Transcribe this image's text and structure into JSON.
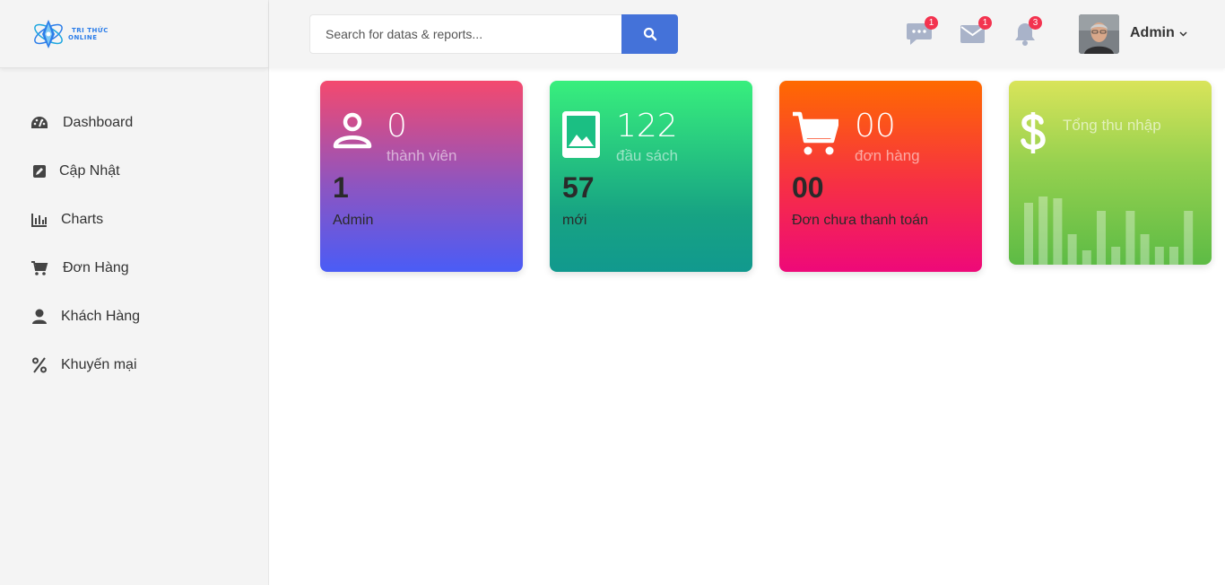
{
  "brand": {
    "line1": "TRI THỨC",
    "line2": "ONLINE"
  },
  "search": {
    "placeholder": "Search for datas & reports..."
  },
  "header": {
    "icons": [
      {
        "name": "chat-icon",
        "badge": "1"
      },
      {
        "name": "mail-icon",
        "badge": "1"
      },
      {
        "name": "bell-icon",
        "badge": "3"
      }
    ],
    "user": {
      "name": "Admin"
    }
  },
  "sidebar": {
    "items": [
      {
        "icon": "dashboard-icon",
        "label": "Dashboard"
      },
      {
        "icon": "edit-icon",
        "label": "Cập Nhật"
      },
      {
        "icon": "chart-icon",
        "label": "Charts"
      },
      {
        "icon": "cart-icon",
        "label": "Đơn Hàng"
      },
      {
        "icon": "user-icon",
        "label": "Khách Hàng"
      },
      {
        "icon": "percent-icon",
        "label": "Khuyến mại"
      }
    ]
  },
  "cards": [
    {
      "icon": "user-icon",
      "value": "0",
      "unit": "thành viên",
      "count": "1",
      "desc": "Admin",
      "colors": [
        "#f4496e",
        "#4a5cf6"
      ]
    },
    {
      "icon": "image-icon",
      "value": "122",
      "unit": "đầu sách",
      "count": "57",
      "desc": "mới",
      "colors": [
        "#38ef7d",
        "#11998e"
      ]
    },
    {
      "icon": "cart-icon",
      "value": "00",
      "unit": "đơn hàng",
      "count": "00",
      "desc": "Đơn chưa thanh toán",
      "colors": [
        "#ff6a00",
        "#ee0979"
      ]
    },
    {
      "icon": "dollar-icon",
      "title": "Tổng thu nhập",
      "sparkline": [
        0.74,
        0.82,
        0.8,
        0.37,
        0.17,
        0.65,
        0.22,
        0.65,
        0.37,
        0.22,
        0.22,
        0.65
      ],
      "colors": [
        "#d9e45a",
        "#5dbb45"
      ]
    }
  ]
}
